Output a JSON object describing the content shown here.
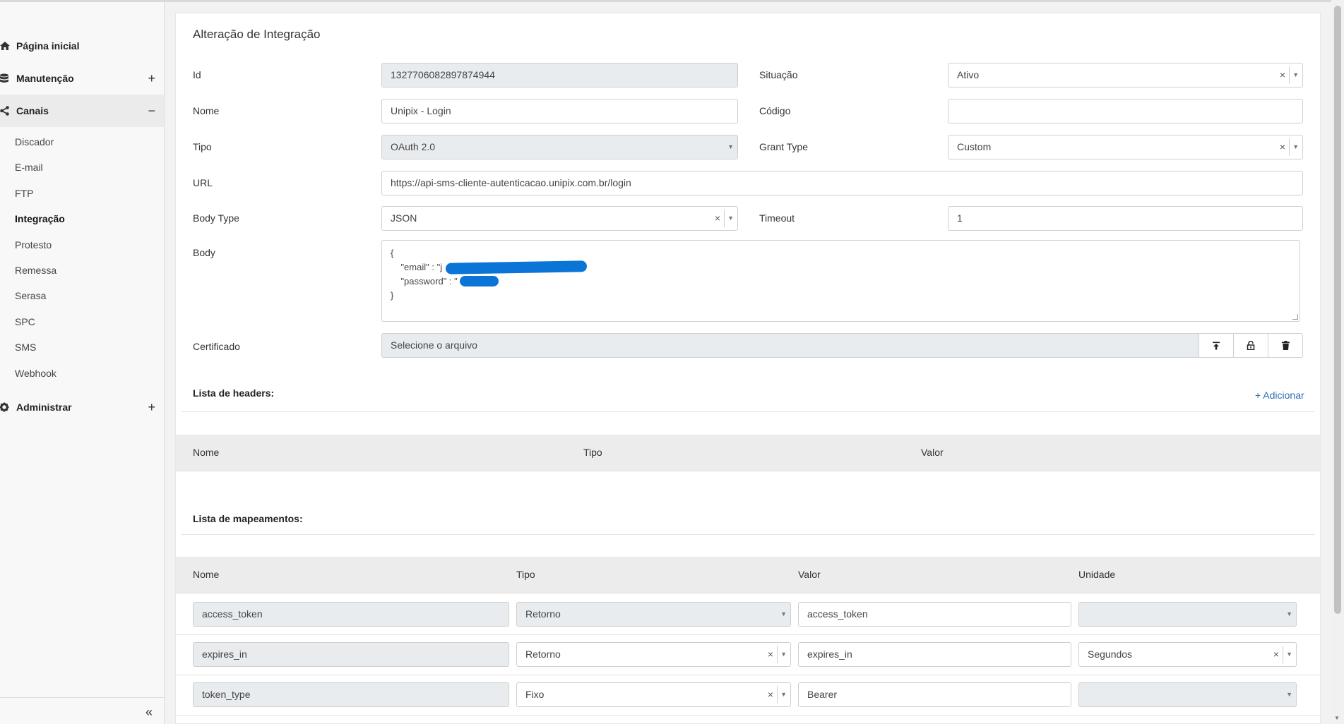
{
  "sidebar": {
    "home": "Página inicial",
    "manutencao": "Manutenção",
    "canais": "Canais",
    "administrar": "Administrar",
    "expand_symbol": "+",
    "collapse_symbol": "−",
    "collapse_sidebar": "«",
    "canais_items": [
      "Discador",
      "E-mail",
      "FTP",
      "Integração",
      "Protesto",
      "Remessa",
      "Serasa",
      "SPC",
      "SMS",
      "Webhook"
    ],
    "active_item": "Integração"
  },
  "form": {
    "title": "Alteração de Integração",
    "id_label": "Id",
    "id_value": "1327706082897874944",
    "situacao_label": "Situação",
    "situacao_value": "Ativo",
    "nome_label": "Nome",
    "nome_value": "Unipix - Login",
    "codigo_label": "Código",
    "codigo_value": "",
    "tipo_label": "Tipo",
    "tipo_value": "OAuth 2.0",
    "grant_type_label": "Grant Type",
    "grant_type_value": "Custom",
    "url_label": "URL",
    "url_value": "https://api-sms-cliente-autenticacao.unipix.com.br/login",
    "body_type_label": "Body Type",
    "body_type_value": "JSON",
    "timeout_label": "Timeout",
    "timeout_value": "1",
    "body_label": "Body",
    "body_lines": [
      "{",
      "    \"email\" : \"j",
      "    \"password\" : \"",
      "}"
    ],
    "certificado_label": "Certificado",
    "certificado_placeholder": "Selecione o arquivo",
    "clear_symbol": "×",
    "caret_symbol": "▼"
  },
  "headers_section": {
    "title": "Lista de headers:",
    "add_label": "+ Adicionar",
    "columns": [
      "Nome",
      "Tipo",
      "Valor"
    ]
  },
  "mappings_section": {
    "title": "Lista de mapeamentos:",
    "columns": [
      "Nome",
      "Tipo",
      "Valor",
      "Unidade"
    ],
    "rows": [
      {
        "nome": "access_token",
        "tipo": "Retorno",
        "valor": "access_token",
        "unidade": ""
      },
      {
        "nome": "expires_in",
        "tipo": "Retorno",
        "valor": "expires_in",
        "unidade": "Segundos"
      },
      {
        "nome": "token_type",
        "tipo": "Fixo",
        "valor": "Bearer",
        "unidade": ""
      }
    ]
  },
  "colors": {
    "redaction": "#0a75d6",
    "link": "#2a6fb5"
  }
}
